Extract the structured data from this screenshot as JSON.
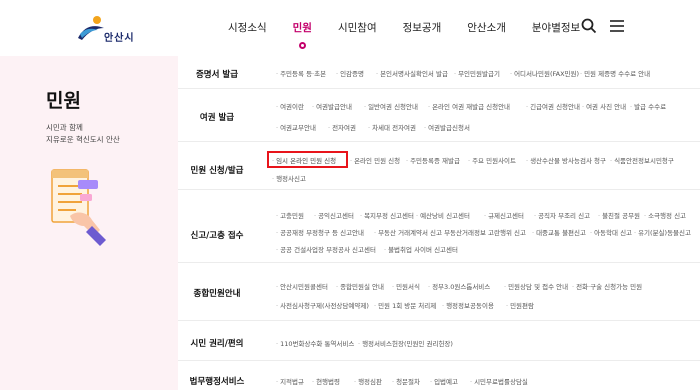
{
  "header": {
    "logo_text": "안산시",
    "nav": [
      "시정소식",
      "민원",
      "시민참여",
      "정보공개",
      "안산소개",
      "분야별정보"
    ],
    "active_nav": "민원",
    "icons": [
      "search-icon",
      "menu-icon"
    ]
  },
  "left_panel": {
    "title": "민원",
    "subtitle_line1": "시민과 함께",
    "subtitle_line2": "지유로운 혁신도시 안산",
    "illustration": "document-hand-illustration"
  },
  "menu": [
    {
      "label": "증명서 발급",
      "items": [
        "주민등록 등·초본",
        "인감증명",
        "본인서명사실확인서 발급",
        "무인민원발급기",
        "어디서나민원(FAX민원)",
        "민원 제증명 수수료 안내"
      ]
    },
    {
      "label": "여권 발급",
      "items": [
        "여권이란",
        "여권발급안내",
        "일반여권 신청안내",
        "온라인 여권 재발급 신청안내",
        "긴급여권 신청안내",
        "여권 사진 안내",
        "발급 수수료",
        "여권교부안내",
        "전자여권",
        "차세대 전자여권",
        "여권발급신청서"
      ]
    },
    {
      "label": "민원 신청/발급",
      "items": [
        "임시 온라인 민원 신청",
        "온라인 민원 신청",
        "주민등록증 재발급",
        "주요 민원사이트",
        "생산수산물 방사능검사 청구",
        "식품안전정보시민청구",
        "행정사신고"
      ]
    },
    {
      "label": "신고/고충 접수",
      "items": [
        "고충민원",
        "공익신고센터",
        "복지부정 신고센터",
        "예산낭비 신고센터",
        "규제신고센터",
        "공직자 부조리 신고",
        "불친절 공무원",
        "소극행정 신고",
        "공공재정 부정청구 등 신고안내",
        "부동산 거래계약서 신고",
        "부동산거래정보 고란행위 신고",
        "대중교통 불편신고",
        "아동학대 신고",
        "유기(분실)동물신고",
        "공공 건설사업장 부정공사 신고센터",
        "불법취업 사이버 신고센터"
      ]
    },
    {
      "label": "종합민원안내",
      "items": [
        "안산시민원콜센터",
        "종합민원실 안내",
        "민원서식",
        "정부3.0원스톱서비스",
        "민원상담 및 접수 안내",
        "전화·구술 신청가능 민원",
        "사전심사청구제(사전상담예약제)",
        "민원 1회 방문 처리제",
        "행정정보공동이용",
        "민원편람"
      ]
    },
    {
      "label": "시민 권리/편의",
      "items": [
        "110번화상수화 통역서비스",
        "행정서비스헌장(민원인 권리헌장)"
      ]
    },
    {
      "label": "법무행정서비스",
      "items": [
        "지적법규",
        "현행법령",
        "행정심판",
        "청문절차",
        "입법예고",
        "시민무료법률상담실"
      ]
    }
  ],
  "highlight_item": "임시 온라인 민원 신청",
  "colors": {
    "accent": "#c3006b",
    "panel_bg": "#fdf2f5",
    "highlight_border": "#e8141b"
  }
}
